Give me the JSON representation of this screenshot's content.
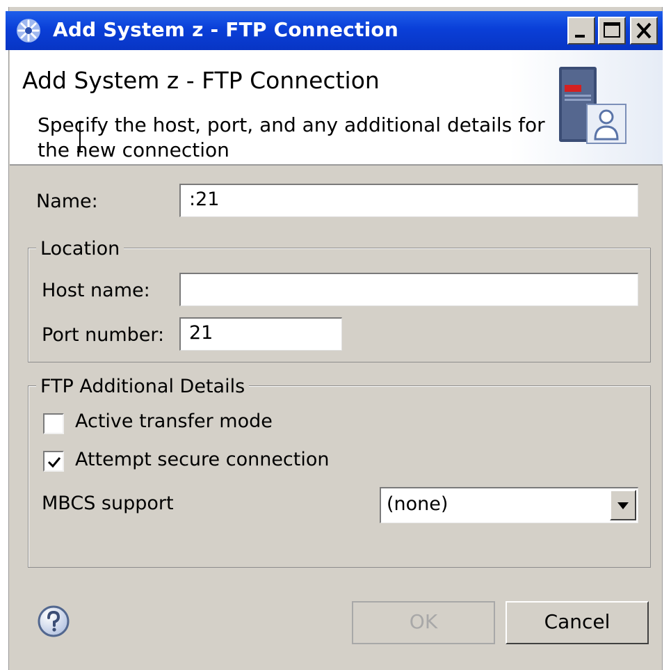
{
  "window": {
    "title": "Add System z - FTP Connection",
    "title_icon": "eclipse-star-icon",
    "buttons": [
      "minimize-icon",
      "maximize-icon",
      "close-icon"
    ]
  },
  "banner": {
    "title": "Add System z - FTP Connection",
    "description": "Specify the host, port, and any additional details for the new connection",
    "image": "server-user-icon"
  },
  "form": {
    "name_label": "Name:",
    "name_value": ":21",
    "location": {
      "legend": "Location",
      "host_label": "Host name:",
      "host_value": "",
      "port_label": "Port number:",
      "port_value": "21"
    },
    "ftp": {
      "legend": "FTP Additional Details",
      "active_label": "Active transfer mode",
      "active_checked": false,
      "secure_label": "Attempt secure connection",
      "secure_checked": true,
      "mbcs_label": "MBCS support",
      "mbcs_value": "(none)"
    }
  },
  "footer": {
    "help_icon": "help-icon",
    "ok_label": "OK",
    "ok_enabled": false,
    "cancel_label": "Cancel"
  },
  "colors": {
    "titlebar": "#0a3fd8",
    "dialog_bg": "#d4d0c8",
    "disabled_text": "#a8a8a8"
  }
}
